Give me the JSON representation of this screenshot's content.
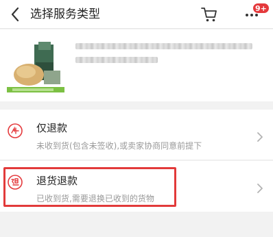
{
  "header": {
    "title": "选择服务类型",
    "back_icon": "chevron-left-icon",
    "cart_icon": "cart-icon",
    "more_icon": "more-dots-icon",
    "badge": "9+",
    "badge_color": "#e4393c"
  },
  "options": [
    {
      "title": "仅退款",
      "subtitle": "未收到货(包含未签收),或卖家协商同意前提下",
      "icon": "refund-icon",
      "icon_char": "退"
    },
    {
      "title": "退货退款",
      "subtitle": "已收到货,需要退换已收到的货物",
      "icon": "return-refund-icon",
      "icon_char": "退"
    }
  ],
  "colors": {
    "accent_red": "#e4393c",
    "highlight": "#e23a3a"
  }
}
